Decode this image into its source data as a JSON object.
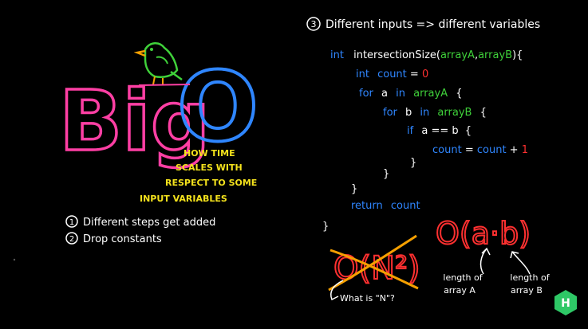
{
  "logo": {
    "big": "Big",
    "o": "O"
  },
  "tagline": {
    "lines": [
      "HOW TIME",
      "SCALES WITH",
      "RESPECT TO SOME",
      "INPUT VARIABLES"
    ]
  },
  "rules": [
    {
      "num": "1",
      "text": "Different steps get added"
    },
    {
      "num": "2",
      "text": "Drop constants"
    }
  ],
  "heading": {
    "num": "3",
    "text": "Different inputs => different variables"
  },
  "code": {
    "line1": {
      "kw": "int",
      "name": "intersectionSize(",
      "a": "arrayA",
      "comma": ",",
      "b": "arrayB",
      "close": "){"
    },
    "line2": {
      "kw": "int",
      "var": "count",
      "eq": " = ",
      "val": "0"
    },
    "line3": {
      "kw": "for",
      "var": "a",
      "in": "in",
      "arr": "arrayA",
      "brace": "{"
    },
    "line4": {
      "kw": "for",
      "var": "b",
      "in": "in",
      "arr": "arrayB",
      "brace": "{"
    },
    "line5": {
      "kw": "if",
      "cond": "a == b",
      "brace": "{"
    },
    "line6": {
      "lhs": "count",
      "eq": " = ",
      "rhs": "count",
      "plus": " + ",
      "one": "1"
    },
    "close1": "}",
    "close2": "}",
    "close3": "}",
    "ret": {
      "kw": "return",
      "var": "count"
    },
    "close4": "}"
  },
  "wrong_answer": {
    "text": "O(N²)",
    "note": "What is \"N\"?"
  },
  "right_answer": {
    "text": "O(a·b)",
    "label_a": [
      "length of",
      "array A"
    ],
    "label_b": [
      "length of",
      "array B"
    ]
  },
  "brand": {
    "letter": "H",
    "icon": "hackerrank-hexagon-icon",
    "color": "#2ec866"
  },
  "colors": {
    "pink": "#ff3fa4",
    "blue": "#2f86ff",
    "yellow": "#f4e21c",
    "green": "#3fd13a",
    "red": "#ff3030",
    "orange": "#f5a000",
    "white": "#ffffff"
  }
}
